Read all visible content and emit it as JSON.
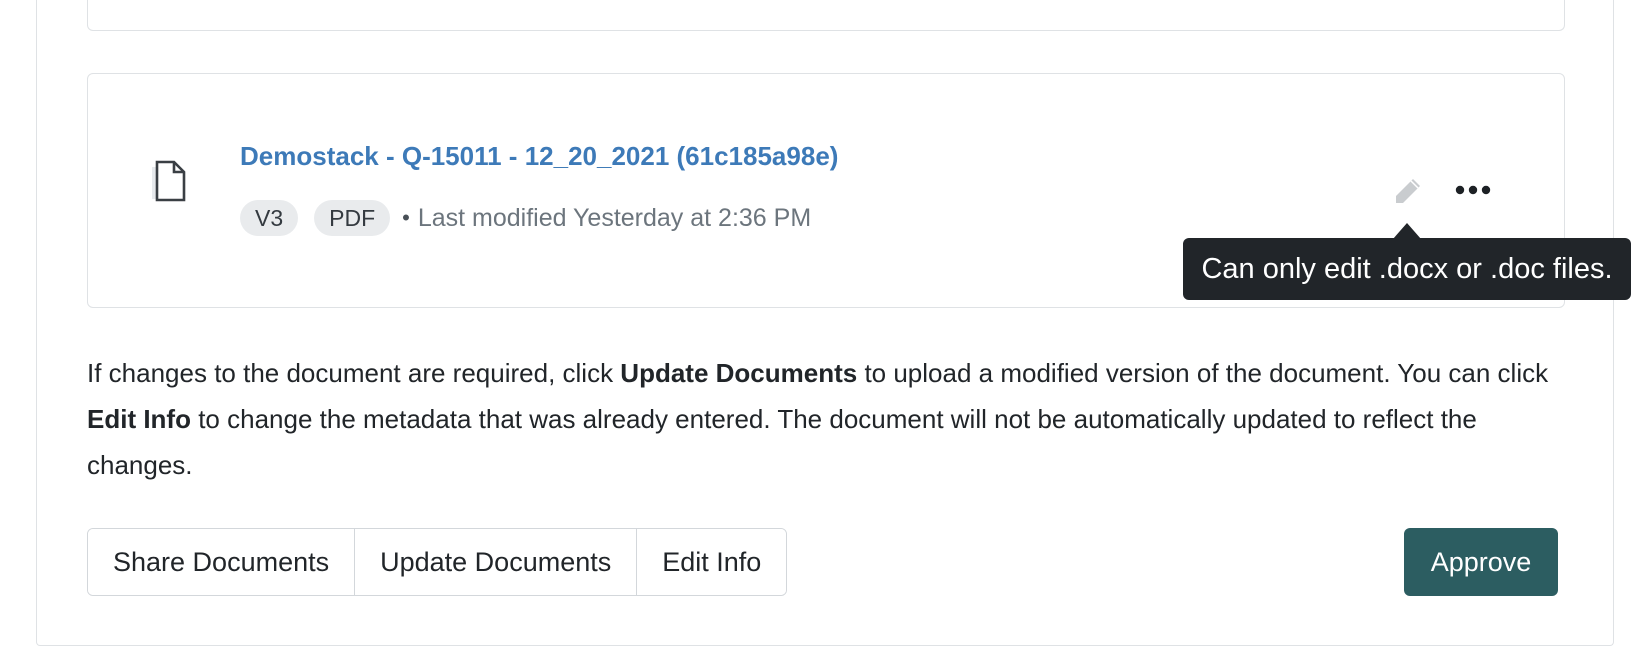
{
  "document": {
    "title": "Demostack - Q-15011 - 12_20_2021 (61c185a98e)",
    "version_badge": "V3",
    "type_badge": "PDF",
    "separator": "•",
    "last_modified": "Last modified Yesterday at 2:36 PM",
    "icon": "file-icon"
  },
  "actions": {
    "edit_icon": "pencil-icon",
    "more_icon": "ellipsis-icon",
    "tooltip": "Can only edit .docx or .doc files."
  },
  "help": {
    "part1": "If changes to the document are required, click ",
    "bold1": "Update Documents",
    "part2": " to upload a modified version of the document. You can click ",
    "bold2": "Edit Info",
    "part3": " to change the metadata that was already entered. The document will not be automatically updated to reflect the changes."
  },
  "buttons": {
    "share": "Share Documents",
    "update": "Update Documents",
    "edit_info": "Edit Info",
    "approve": "Approve"
  },
  "colors": {
    "link": "#3d7ab8",
    "approve_bg": "#2c5d61",
    "tooltip_bg": "#212529"
  }
}
